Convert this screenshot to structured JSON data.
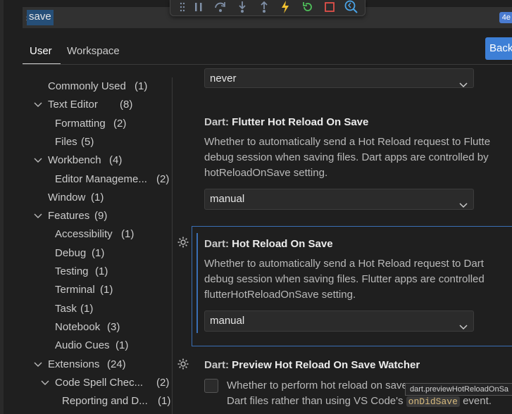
{
  "search": {
    "value": "save",
    "result_count": "4e"
  },
  "debug_toolbar": {
    "icons": [
      "grip-icon",
      "pause-icon",
      "step-over-icon",
      "step-into-icon",
      "step-out-icon",
      "hot-reload-icon",
      "restart-icon",
      "stop-icon",
      "inspect-widget-icon"
    ],
    "colors": {
      "default": "#7f8fa6",
      "hot_reload": "#f2c230",
      "restart": "#4fbf5a",
      "stop": "#e0504a",
      "inspect": "#4aa3e6"
    }
  },
  "tabs": {
    "user": "User",
    "workspace": "Workspace"
  },
  "backup_button": "Back",
  "toc": [
    {
      "label": "Commonly Used",
      "count": "(1)"
    },
    {
      "label": "Text Editor",
      "count": "(8)"
    },
    {
      "label": "Formatting",
      "count": "(2)"
    },
    {
      "label": "Files",
      "count": "(5)"
    },
    {
      "label": "Workbench",
      "count": "(4)"
    },
    {
      "label": "Editor Manageme...",
      "count": "(2)"
    },
    {
      "label": "Window",
      "count": "(1)"
    },
    {
      "label": "Features",
      "count": "(9)"
    },
    {
      "label": "Accessibility",
      "count": "(1)"
    },
    {
      "label": "Debug",
      "count": "(1)"
    },
    {
      "label": "Testing",
      "count": "(1)"
    },
    {
      "label": "Terminal",
      "count": "(1)"
    },
    {
      "label": "Task",
      "count": "(1)"
    },
    {
      "label": "Notebook",
      "count": "(3)"
    },
    {
      "label": "Audio Cues",
      "count": "(1)"
    },
    {
      "label": "Extensions",
      "count": "(24)"
    },
    {
      "label": "Code Spell Chec...",
      "count": "(2)"
    },
    {
      "label": "Reporting and D...",
      "count": "(1)"
    }
  ],
  "settings": {
    "top_select": {
      "value": "never"
    },
    "flutter_hot_reload": {
      "category": "Dart: ",
      "name": "Flutter Hot Reload On Save",
      "desc1": "Whether to automatically send a Hot Reload request to Flutte",
      "desc2": "debug session when saving files. Dart apps are controlled by",
      "desc3": "hotReloadOnSave setting.",
      "value": "manual"
    },
    "hot_reload": {
      "category": "Dart: ",
      "name": "Hot Reload On Save",
      "desc1": "Whether to automatically send a Hot Reload request to Dart",
      "desc2": "debug session when saving files. Flutter apps are controlled",
      "desc3": "flutterHotReloadOnSave setting.",
      "value": "manual"
    },
    "preview_watcher": {
      "category": "Dart: ",
      "name": "Preview Hot Reload On Save Watcher",
      "desc1": "Whether to perform hot reload on save",
      "desc2_pre": "Dart files rather than using VS Code's",
      "desc2_code": "onDidSave",
      "desc2_post": "event.",
      "tooltip": "dart.previewHotReloadOnSa"
    }
  }
}
